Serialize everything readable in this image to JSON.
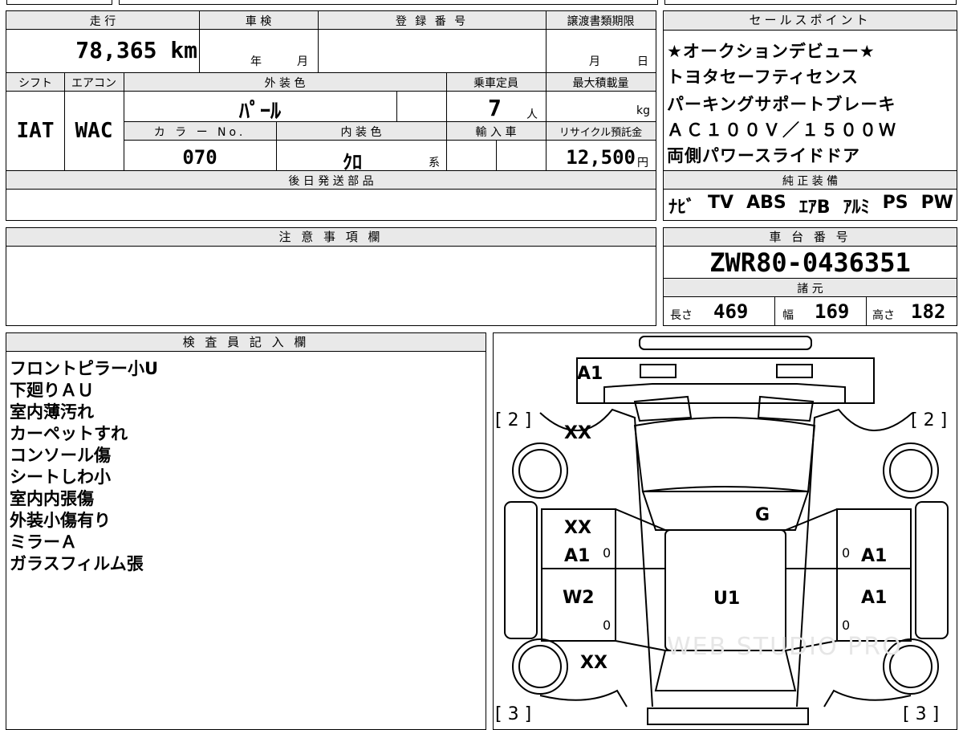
{
  "vehicle_box": {
    "mileage_label": "走 行",
    "mileage_value": "78,365 km",
    "inspection_label": "車 検",
    "inspection_year": "年",
    "inspection_month": "月",
    "registration_label": "登 録 番 号",
    "transfer_label": "譲渡書類期限",
    "transfer_month": "月",
    "transfer_day": "日",
    "shift_label": "シフト",
    "shift_value": "IAT",
    "ac_label": "エアコン",
    "ac_value": "WAC",
    "exterior_label": "外 装 色",
    "exterior_value": "ﾊﾟｰﾙ",
    "capacity_label": "乗車定員",
    "capacity_value": "7",
    "capacity_unit": "人",
    "maxload_label": "最大積載量",
    "maxload_unit": "kg",
    "color_no_label": "カ ラ ー No.",
    "color_no_value": "070",
    "interior_label": "内 装 色",
    "interior_value": "ｸﾛ",
    "interior_suffix": "系",
    "import_label": "輸 入 車",
    "recycle_label": "リサイクル預託金",
    "recycle_value": "12,500",
    "recycle_unit": "円",
    "later_parts_label": "後 日 発 送 部 品"
  },
  "sales_points": {
    "header": "セールスポイント",
    "lines": [
      "★オークションデビュー★",
      "トヨタセーフティセンス",
      "パーキングサポートブレーキ",
      "ＡＣ１００Ｖ／１５００Ｗ",
      "両側パワースライドドア"
    ]
  },
  "equipment": {
    "header": "純 正 装 備",
    "items": [
      "ﾅﾋﾞ",
      "TV",
      "ABS",
      "ｴｱB",
      "ｱﾙﾐ",
      "PS",
      "PW"
    ]
  },
  "notes": {
    "header": "注 意 事 項 欄"
  },
  "chassis": {
    "header": "車 台 番 号",
    "number": "ZWR80-0436351",
    "specs_header": "諸 元",
    "length_label": "長さ",
    "length_value": "469",
    "width_label": "幅",
    "width_value": "169",
    "height_label": "高さ",
    "height_value": "182"
  },
  "inspector": {
    "header": "検 査 員 記 入 欄",
    "remarks": [
      "フロントピラー小U",
      "下廻りＡＵ",
      "室内薄汚れ",
      "カーペットすれ",
      "コンソール傷",
      "シートしわ小",
      "室内内張傷",
      "外装小傷有り",
      "ミラーＡ",
      "ガラスフィルム張"
    ]
  },
  "diagram": {
    "marks": {
      "front_bumper": "A1",
      "left_front_fender": "XX",
      "left_front_door_1": "XX",
      "left_front_door_2": "A1",
      "left_rear_door": "W2",
      "left_rear_fender": "XX",
      "roof_front": "G",
      "roof_center": "U1",
      "right_front_door": "A1",
      "right_rear_door": "A1"
    },
    "zeros": [
      "0",
      "0",
      "0",
      "0"
    ],
    "brackets": {
      "front_left": "[ 2 ]",
      "front_right": "[ 2 ]",
      "rear_left": "[ 3 ]",
      "rear_right": "[ 3 ]"
    },
    "watermark": "WEB STUDIO PRO"
  }
}
